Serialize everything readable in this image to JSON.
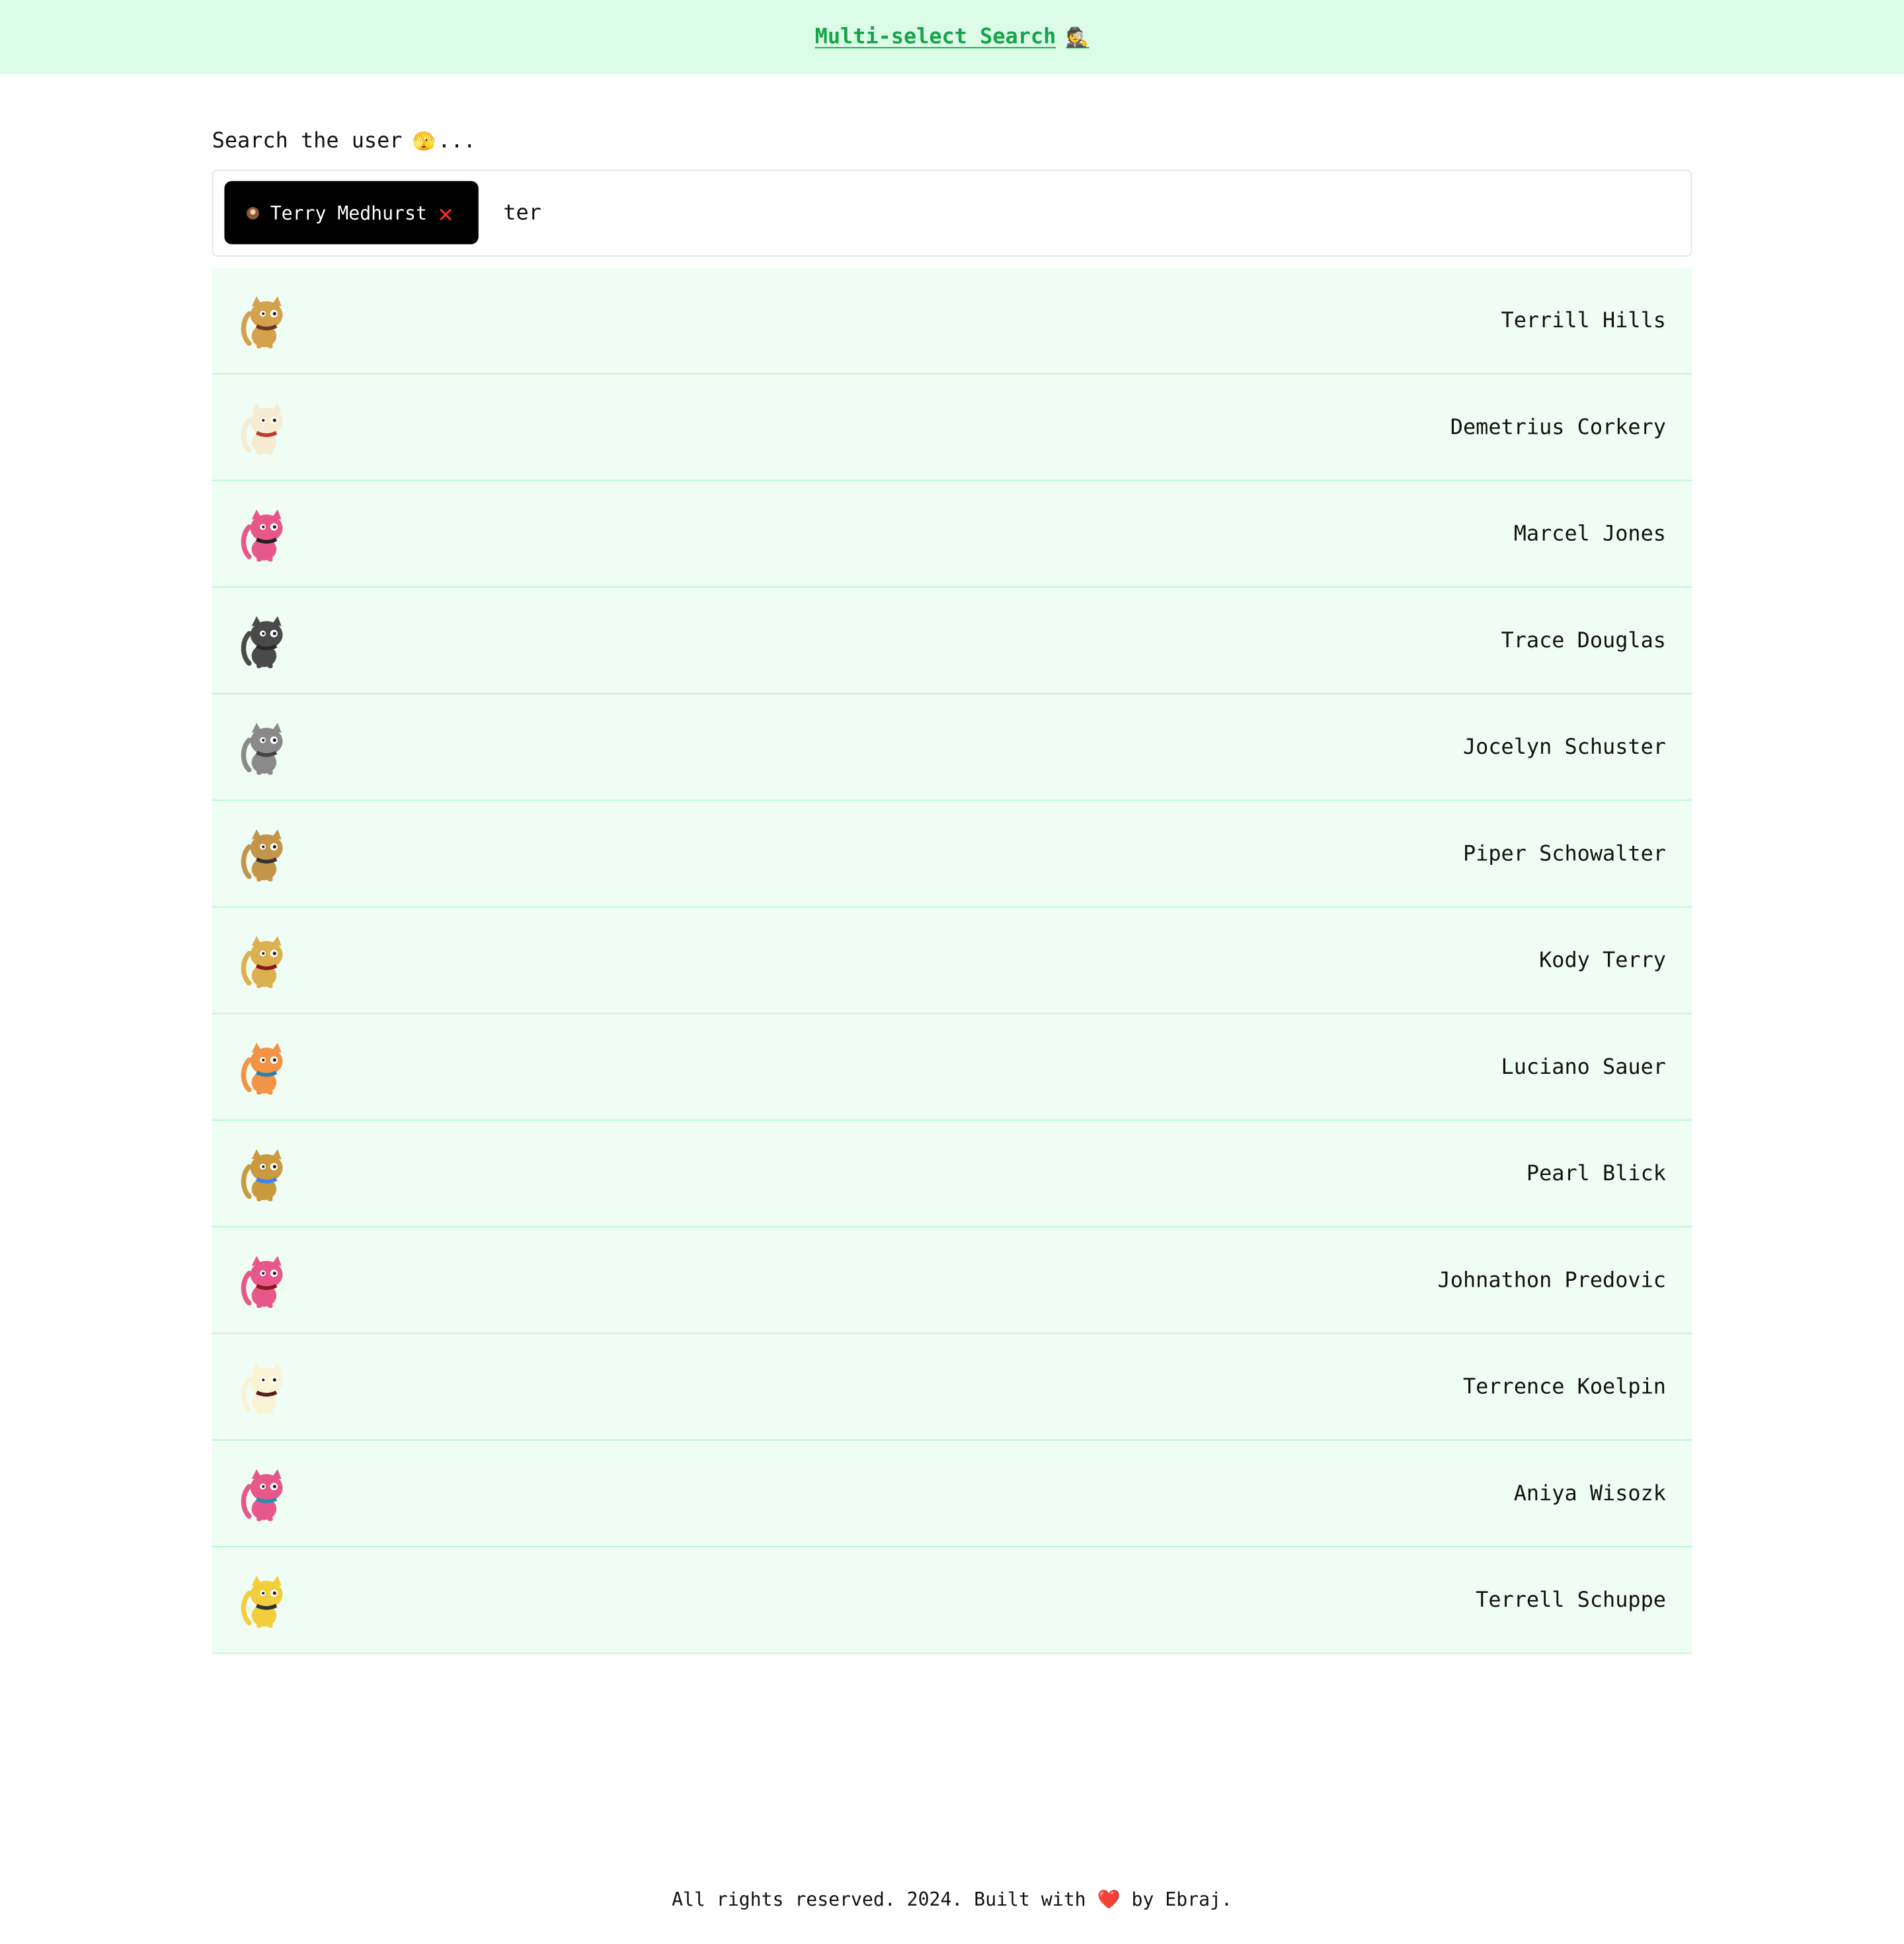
{
  "header": {
    "title": "Multi-select Search",
    "title_emoji": "🕵️"
  },
  "search": {
    "label": "Search the user",
    "label_emoji": "🫣",
    "label_suffix": "...",
    "query": "ter",
    "selected": [
      {
        "name": "Terry Medhurst",
        "avatar_color": "#8b5a3c",
        "remove_icon": "✕"
      }
    ]
  },
  "results": [
    {
      "name": "Terrill Hills",
      "avatar_icon": "cat-avatar-icon",
      "body_color": "#d4a24c",
      "accent_color": "#6b3a1f"
    },
    {
      "name": "Demetrius Corkery",
      "avatar_icon": "cat-avatar-icon",
      "body_color": "#f5ecd2",
      "accent_color": "#c0392b"
    },
    {
      "name": "Marcel Jones",
      "avatar_icon": "cat-avatar-icon",
      "body_color": "#e8578a",
      "accent_color": "#222222"
    },
    {
      "name": "Trace Douglas",
      "avatar_icon": "cat-avatar-icon",
      "body_color": "#4a4a4a",
      "accent_color": "#2b2b2b"
    },
    {
      "name": "Jocelyn Schuster",
      "avatar_icon": "cat-avatar-icon",
      "body_color": "#8a8a8a",
      "accent_color": "#444444"
    },
    {
      "name": "Piper Schowalter",
      "avatar_icon": "cat-avatar-icon",
      "body_color": "#c4944a",
      "accent_color": "#333333"
    },
    {
      "name": "Kody Terry",
      "avatar_icon": "cat-avatar-icon",
      "body_color": "#dcb04e",
      "accent_color": "#8b1a1a"
    },
    {
      "name": "Luciano Sauer",
      "avatar_icon": "cat-avatar-icon",
      "body_color": "#f29345",
      "accent_color": "#2980b9"
    },
    {
      "name": "Pearl Blick",
      "avatar_icon": "cat-avatar-icon",
      "body_color": "#c99a3e",
      "accent_color": "#3b82f6"
    },
    {
      "name": "Johnathon Predovic",
      "avatar_icon": "cat-avatar-icon",
      "body_color": "#e8578a",
      "accent_color": "#8b1a1a"
    },
    {
      "name": "Terrence Koelpin",
      "avatar_icon": "cat-avatar-icon",
      "body_color": "#faf3d6",
      "accent_color": "#5a1a1a"
    },
    {
      "name": "Aniya Wisozk",
      "avatar_icon": "cat-avatar-icon",
      "body_color": "#e8578a",
      "accent_color": "#2a8cb0"
    },
    {
      "name": "Terrell Schuppe",
      "avatar_icon": "cat-avatar-icon",
      "body_color": "#f2cd3c",
      "accent_color": "#333333"
    }
  ],
  "footer": {
    "text_before": "All rights reserved. 2024. Built with",
    "heart": "❤️",
    "text_after": "by Ebraj."
  },
  "colors": {
    "header_bg": "#dcfce7",
    "header_link": "#16a34a",
    "row_bg": "#f0fdf4",
    "row_border": "#bbf7d0",
    "pill_bg": "#000000",
    "remove": "#ff2b2b"
  }
}
